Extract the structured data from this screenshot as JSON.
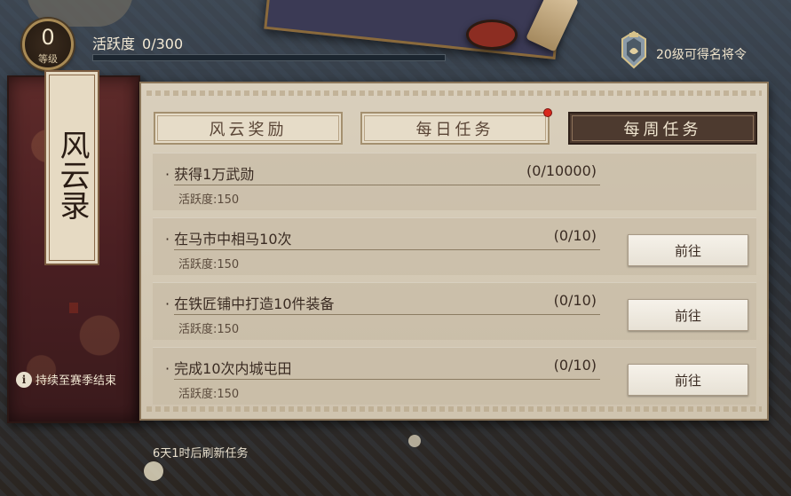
{
  "player": {
    "level": "0",
    "level_label": "等级"
  },
  "activity": {
    "label": "活跃度",
    "value": "0/300",
    "progress": 0
  },
  "reward_hint": {
    "icon": "general-badge-icon",
    "text": "20级可得名将令"
  },
  "scroll": {
    "title": "风云录",
    "season_icon": "info-icon",
    "season_text": "持续至赛季结束"
  },
  "tabs": [
    {
      "label": "风云奖励",
      "active": false,
      "has_dot": false
    },
    {
      "label": "每日任务",
      "active": false,
      "has_dot": true
    },
    {
      "label": "每周任务",
      "active": true,
      "has_dot": false
    }
  ],
  "tasks": [
    {
      "name": "· 获得1万武勋",
      "progress": "(0/10000)",
      "reward": "活跃度:150",
      "button": null
    },
    {
      "name": "· 在马市中相马10次",
      "progress": "(0/10)",
      "reward": "活跃度:150",
      "button": "前往"
    },
    {
      "name": "· 在铁匠铺中打造10件装备",
      "progress": "(0/10)",
      "reward": "活跃度:150",
      "button": "前往"
    },
    {
      "name": "· 完成10次内城屯田",
      "progress": "(0/10)",
      "reward": "活跃度:150",
      "button": "前往"
    }
  ],
  "refresh_text": "6天1时后刷新任务",
  "colors": {
    "active_tab": "#4d3a2f",
    "panel": "#d9cfbc",
    "badge_dot": "#d9281c",
    "scroll_red": "#5e2b2a"
  }
}
